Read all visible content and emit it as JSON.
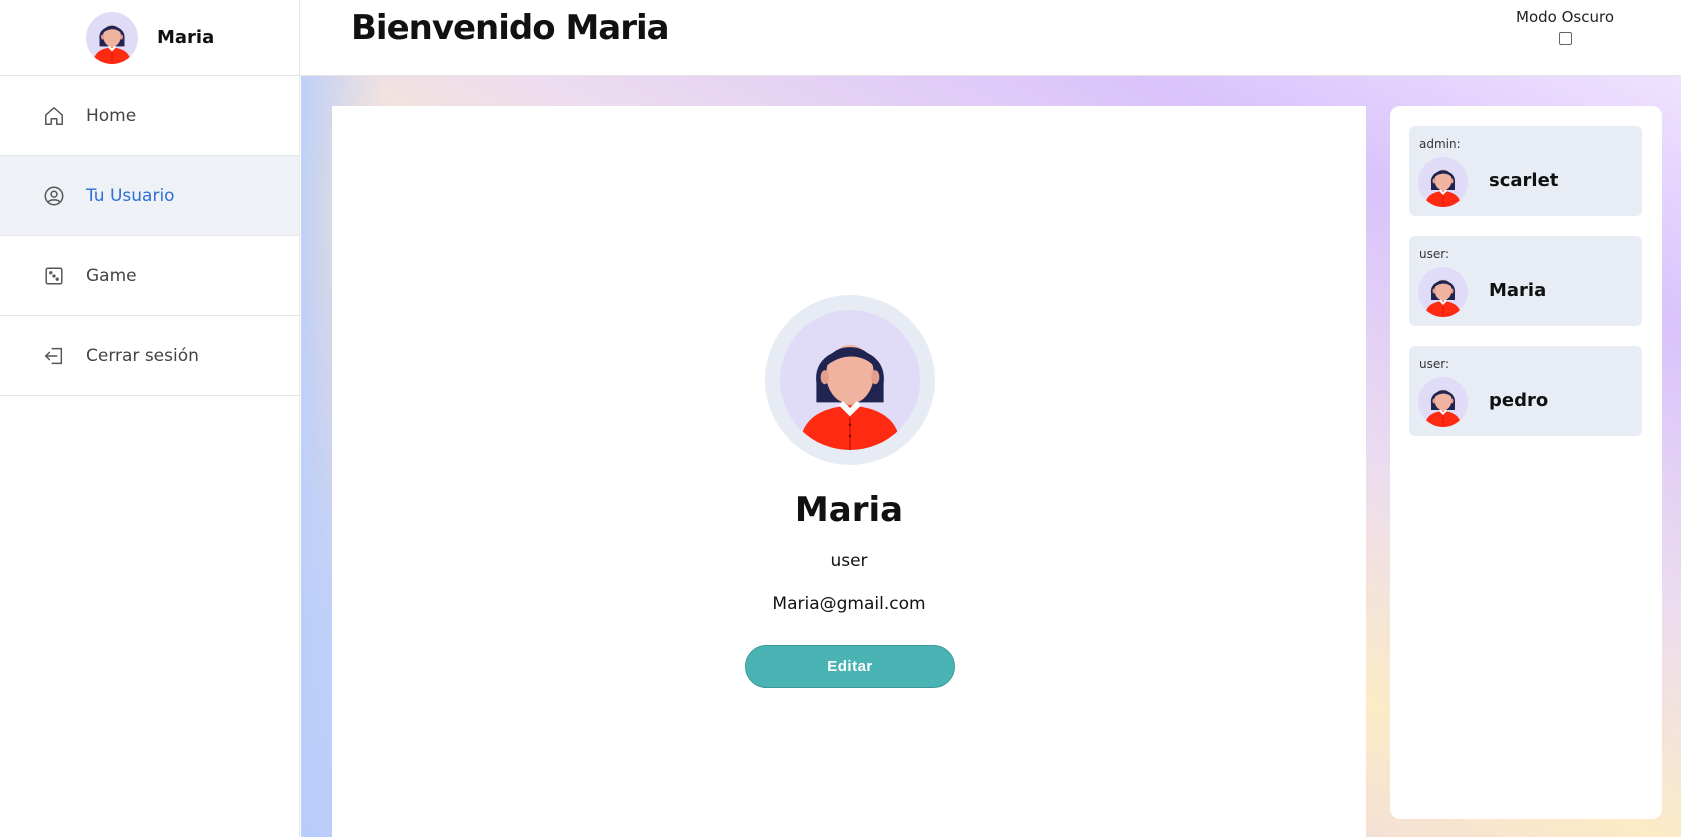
{
  "sidebar": {
    "user_name": "Maria",
    "items": [
      {
        "label": "Home",
        "icon": "home-icon",
        "active": false
      },
      {
        "label": "Tu Usuario",
        "icon": "user-circle-icon",
        "active": true
      },
      {
        "label": "Game",
        "icon": "dice-icon",
        "active": false
      },
      {
        "label": "Cerrar sesión",
        "icon": "logout-icon",
        "active": false
      }
    ]
  },
  "header": {
    "title": "Bienvenido Maria",
    "dark_mode_label": "Modo Oscuro",
    "dark_mode_checked": false
  },
  "profile": {
    "name": "Maria",
    "role": "user",
    "email": "Maria@gmail.com",
    "edit_label": "Editar"
  },
  "users": [
    {
      "role": "admin:",
      "name": "scarlet"
    },
    {
      "role": "user:",
      "name": "Maria"
    },
    {
      "role": "user:",
      "name": "pedro"
    }
  ],
  "colors": {
    "accent_blue": "#2f6fd6",
    "edit_button": "#4ab3b3",
    "active_nav_bg": "#eef1f6",
    "user_card_bg": "#e8edf5"
  }
}
